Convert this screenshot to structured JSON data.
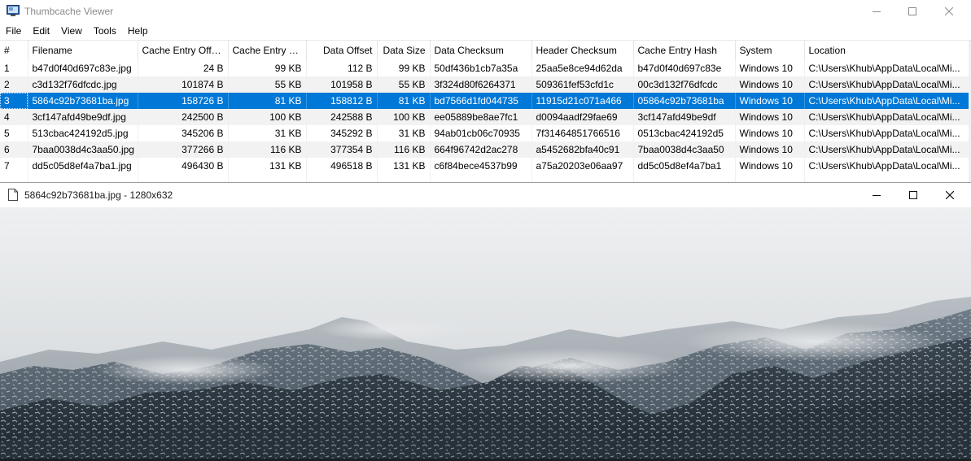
{
  "app": {
    "title": "Thumbcache Viewer",
    "menu": [
      "File",
      "Edit",
      "View",
      "Tools",
      "Help"
    ]
  },
  "table": {
    "columns": [
      "#",
      "Filename",
      "Cache Entry Offset",
      "Cache Entry S...",
      "Data Offset",
      "Data Size",
      "Data Checksum",
      "Header Checksum",
      "Cache Entry Hash",
      "System",
      "Location"
    ],
    "selected_index": 2,
    "rows": [
      [
        "1",
        "b47d0f40d697c83e.jpg",
        "24 B",
        "99 KB",
        "112 B",
        "99 KB",
        "50df436b1cb7a35a",
        "25aa5e8ce94d62da",
        "b47d0f40d697c83e",
        "Windows 10",
        "C:\\Users\\Khub\\AppData\\Local\\Mi..."
      ],
      [
        "2",
        "c3d132f76dfcdc.jpg",
        "101874 B",
        "55 KB",
        "101958 B",
        "55 KB",
        "3f324d80f6264371",
        "509361fef53cfd1c",
        "00c3d132f76dfcdc",
        "Windows 10",
        "C:\\Users\\Khub\\AppData\\Local\\Mi..."
      ],
      [
        "3",
        "5864c92b73681ba.jpg",
        "158726 B",
        "81 KB",
        "158812 B",
        "81 KB",
        "bd7566d1fd044735",
        "11915d21c071a466",
        "05864c92b73681ba",
        "Windows 10",
        "C:\\Users\\Khub\\AppData\\Local\\Mi..."
      ],
      [
        "4",
        "3cf147afd49be9df.jpg",
        "242500 B",
        "100 KB",
        "242588 B",
        "100 KB",
        "ee05889be8ae7fc1",
        "d0094aadf29fae69",
        "3cf147afd49be9df",
        "Windows 10",
        "C:\\Users\\Khub\\AppData\\Local\\Mi..."
      ],
      [
        "5",
        "513cbac424192d5.jpg",
        "345206 B",
        "31 KB",
        "345292 B",
        "31 KB",
        "94ab01cb06c70935",
        "7f31464851766516",
        "0513cbac424192d5",
        "Windows 10",
        "C:\\Users\\Khub\\AppData\\Local\\Mi..."
      ],
      [
        "6",
        "7baa0038d4c3aa50.jpg",
        "377266 B",
        "116 KB",
        "377354 B",
        "116 KB",
        "664f96742d2ac278",
        "a5452682bfa40c91",
        "7baa0038d4c3aa50",
        "Windows 10",
        "C:\\Users\\Khub\\AppData\\Local\\Mi..."
      ],
      [
        "7",
        "dd5c05d8ef4a7ba1.jpg",
        "496430 B",
        "131 KB",
        "496518 B",
        "131 KB",
        "c6f84bece4537b99",
        "a75a20203e06aa97",
        "dd5c05d8ef4a7ba1",
        "Windows 10",
        "C:\\Users\\Khub\\AppData\\Local\\Mi..."
      ]
    ]
  },
  "viewer": {
    "title": "5864c92b73681ba.jpg - 1280x632"
  },
  "icons": {
    "app": "app-window-icon",
    "minimize": "minimize-icon",
    "maximize": "maximize-icon",
    "close": "close-icon",
    "document": "document-icon"
  },
  "colors": {
    "selection": "#0078d7",
    "stripe": "#f2f2f2"
  }
}
